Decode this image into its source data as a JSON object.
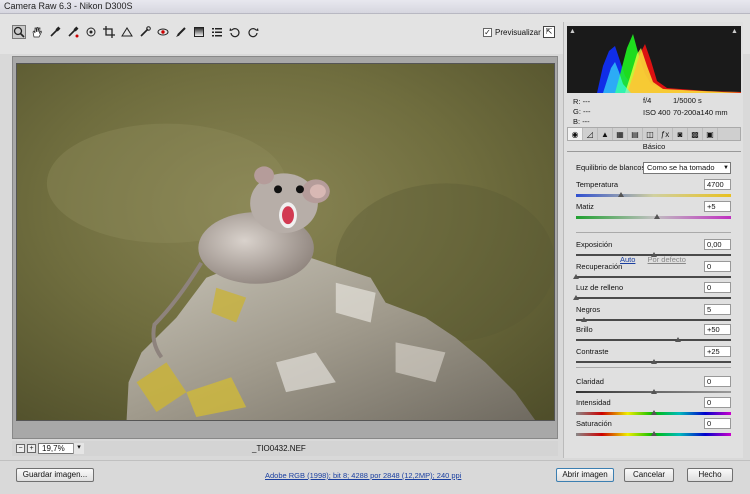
{
  "window": {
    "title": "Camera Raw 6.3 -  Nikon D300S"
  },
  "toolbar": {
    "tools": [
      "zoom-icon",
      "hand-icon",
      "white-balance-icon",
      "color-sampler-icon",
      "target-adjust-icon",
      "crop-icon",
      "straighten-icon",
      "spot-removal-icon",
      "red-eye-icon",
      "adjustment-brush-icon",
      "graduated-filter-icon",
      "preferences-icon",
      "rotate-ccw-icon",
      "rotate-cw-icon"
    ],
    "preview_label": "Previsualizar",
    "preview_checked": "✓"
  },
  "canvas": {
    "filename": "_TIO0432.NEF"
  },
  "zoom": {
    "minus": "−",
    "plus": "+",
    "value": "19,7%",
    "dropdown": "▾"
  },
  "histogram": {
    "r": "R:",
    "g": "G:",
    "b": "B:",
    "r_val": "---",
    "g_val": "---",
    "b_val": "---"
  },
  "exif": {
    "aperture": "f/4",
    "shutter": "1/5000 s",
    "iso": "ISO 400",
    "lens": "70-200a140 mm"
  },
  "panel": {
    "title": "Básico",
    "tab_icons": [
      "basic-icon",
      "tone-curve-icon",
      "detail-icon",
      "hsl-icon",
      "split-toning-icon",
      "lens-correction-icon",
      "effects-icon",
      "camera-calibration-icon",
      "presets-icon",
      "snapshots-icon"
    ],
    "wb_label": "Equilibrio de blancos:",
    "wb_value": "Como se ha tomado",
    "auto": "Auto",
    "default": "Por defecto",
    "sliders": [
      {
        "label": "Temperatura",
        "value": "4700",
        "pos": 0.29
      },
      {
        "label": "Matiz",
        "value": "+5",
        "pos": 0.52
      },
      {
        "label": "Exposición",
        "value": "0,00",
        "pos": 0.5
      },
      {
        "label": "Recuperación",
        "value": "0",
        "pos": 0.0
      },
      {
        "label": "Luz de relleno",
        "value": "0",
        "pos": 0.0
      },
      {
        "label": "Negros",
        "value": "5",
        "pos": 0.05
      },
      {
        "label": "Brillo",
        "value": "+50",
        "pos": 0.66
      },
      {
        "label": "Contraste",
        "value": "+25",
        "pos": 0.5
      },
      {
        "label": "Claridad",
        "value": "0",
        "pos": 0.5
      },
      {
        "label": "Intensidad",
        "value": "0",
        "pos": 0.5
      },
      {
        "label": "Saturación",
        "value": "0",
        "pos": 0.5
      }
    ]
  },
  "bottom": {
    "save": "Guardar imagen...",
    "workflow": "Adobe RGB (1998); bit 8; 4288 por 2848 (12,2MP); 240 ppi",
    "open": "Abrir imagen",
    "cancel": "Cancelar",
    "done": "Hecho"
  }
}
